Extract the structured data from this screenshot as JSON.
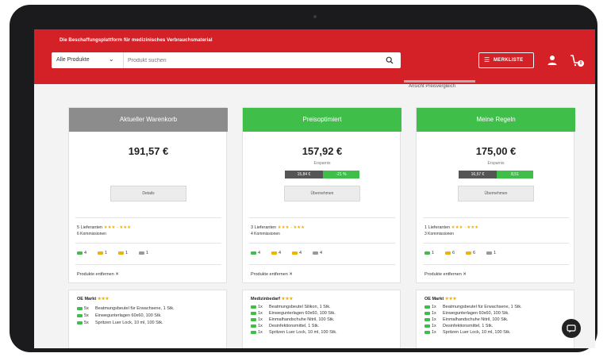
{
  "header": {
    "tagline": "Die Beschaffungsplattform für medizinisches Verbrauchsmaterial",
    "category_selected": "Alle Produkte",
    "search_placeholder": "Produkt suchen",
    "watchlist_label": "MERKLISTE",
    "cart_badge": "0"
  },
  "tab": {
    "label": "Ansicht Preisvergleich"
  },
  "columns": [
    {
      "header": "Aktueller Warenkorb",
      "header_color": "#8c8c8c",
      "price": "191,57 €",
      "savings_label": "",
      "bar_left": "",
      "bar_right": "",
      "button_label": "Details",
      "suppliers": "5 Lieferanten",
      "rating": "★★★ - ★★★",
      "commission": "6 Kommissionen",
      "shipments": [
        {
          "count": "4",
          "color": "#3fbf4a"
        },
        {
          "count": "1",
          "color": "#f0b400"
        },
        {
          "count": "1",
          "color": "#f0b400"
        },
        {
          "count": "1",
          "color": "#999999"
        }
      ],
      "add_products": "Produkte entfernen ✕",
      "supplier_block": {
        "name": "OE Markt",
        "rating": "★★★",
        "lines": [
          {
            "qty": "5x",
            "text": "Beatmungsbeutel für Erwachsene, 1 Stk."
          },
          {
            "qty": "5x",
            "text": "Einwegunterlagen 60x60, 100 Stk."
          },
          {
            "qty": "5x",
            "text": "Spritzen Luer Lock, 10 ml, 100 Stk."
          }
        ]
      }
    },
    {
      "header": "Preisoptimiert",
      "header_color": "#3fbf4a",
      "price": "157,92 €",
      "savings_label": "Ersparnis",
      "bar_left": "15,84 €",
      "bar_right": "-21 %",
      "button_label": "Übernehmen",
      "suppliers": "3 Lieferanten",
      "rating": "★★★ - ★★★",
      "commission": "4 Kommissionen",
      "shipments": [
        {
          "count": "4",
          "color": "#3fbf4a"
        },
        {
          "count": "4",
          "color": "#f0b400"
        },
        {
          "count": "4",
          "color": "#f0b400"
        },
        {
          "count": "4",
          "color": "#999999"
        }
      ],
      "add_products": "Produkte entfernen ✕",
      "supplier_block": {
        "name": "Medizinbedarf",
        "rating": "★★★",
        "lines": [
          {
            "qty": "1x",
            "text": "Beatmungsbeutel Silikon, 1 Stk."
          },
          {
            "qty": "1x",
            "text": "Einwegunterlagen 60x60, 100 Stk."
          },
          {
            "qty": "1x",
            "text": "Einmalhandschuhe Nitril, 100 Stk."
          },
          {
            "qty": "1x",
            "text": "Desinfektionsmittel, 1 Stk."
          },
          {
            "qty": "1x",
            "text": "Spritzen Luer Lock, 10 ml, 100 Stk."
          }
        ]
      }
    },
    {
      "header": "Meine Regeln",
      "header_color": "#3fbf4a",
      "price": "175,00 €",
      "savings_label": "Ersparnis",
      "bar_left": "16,57 €",
      "bar_right": "8,51",
      "button_label": "Übernehmen",
      "suppliers": "1 Lieferanten",
      "rating": "★★★ - ★★★",
      "commission": "3 Kommissionen",
      "shipments": [
        {
          "count": "1",
          "color": "#3fbf4a"
        },
        {
          "count": "6",
          "color": "#f0b400"
        },
        {
          "count": "6",
          "color": "#f0b400"
        },
        {
          "count": "1",
          "color": "#999999"
        }
      ],
      "add_products": "Produkte entfernen ✕",
      "supplier_block": {
        "name": "OE Markt",
        "rating": "★★★",
        "lines": [
          {
            "qty": "1x",
            "text": "Beatmungsbeutel für Erwachsene, 1 Stk."
          },
          {
            "qty": "1x",
            "text": "Einwegunterlagen 60x60, 100 Stk."
          },
          {
            "qty": "1x",
            "text": "Einmalhandschuhe Nitril, 100 Stk."
          },
          {
            "qty": "1x",
            "text": "Desinfektionsmittel, 1 Stk."
          },
          {
            "qty": "1x",
            "text": "Spritzen Luer Lock, 10 ml, 100 Stk."
          }
        ]
      }
    }
  ]
}
